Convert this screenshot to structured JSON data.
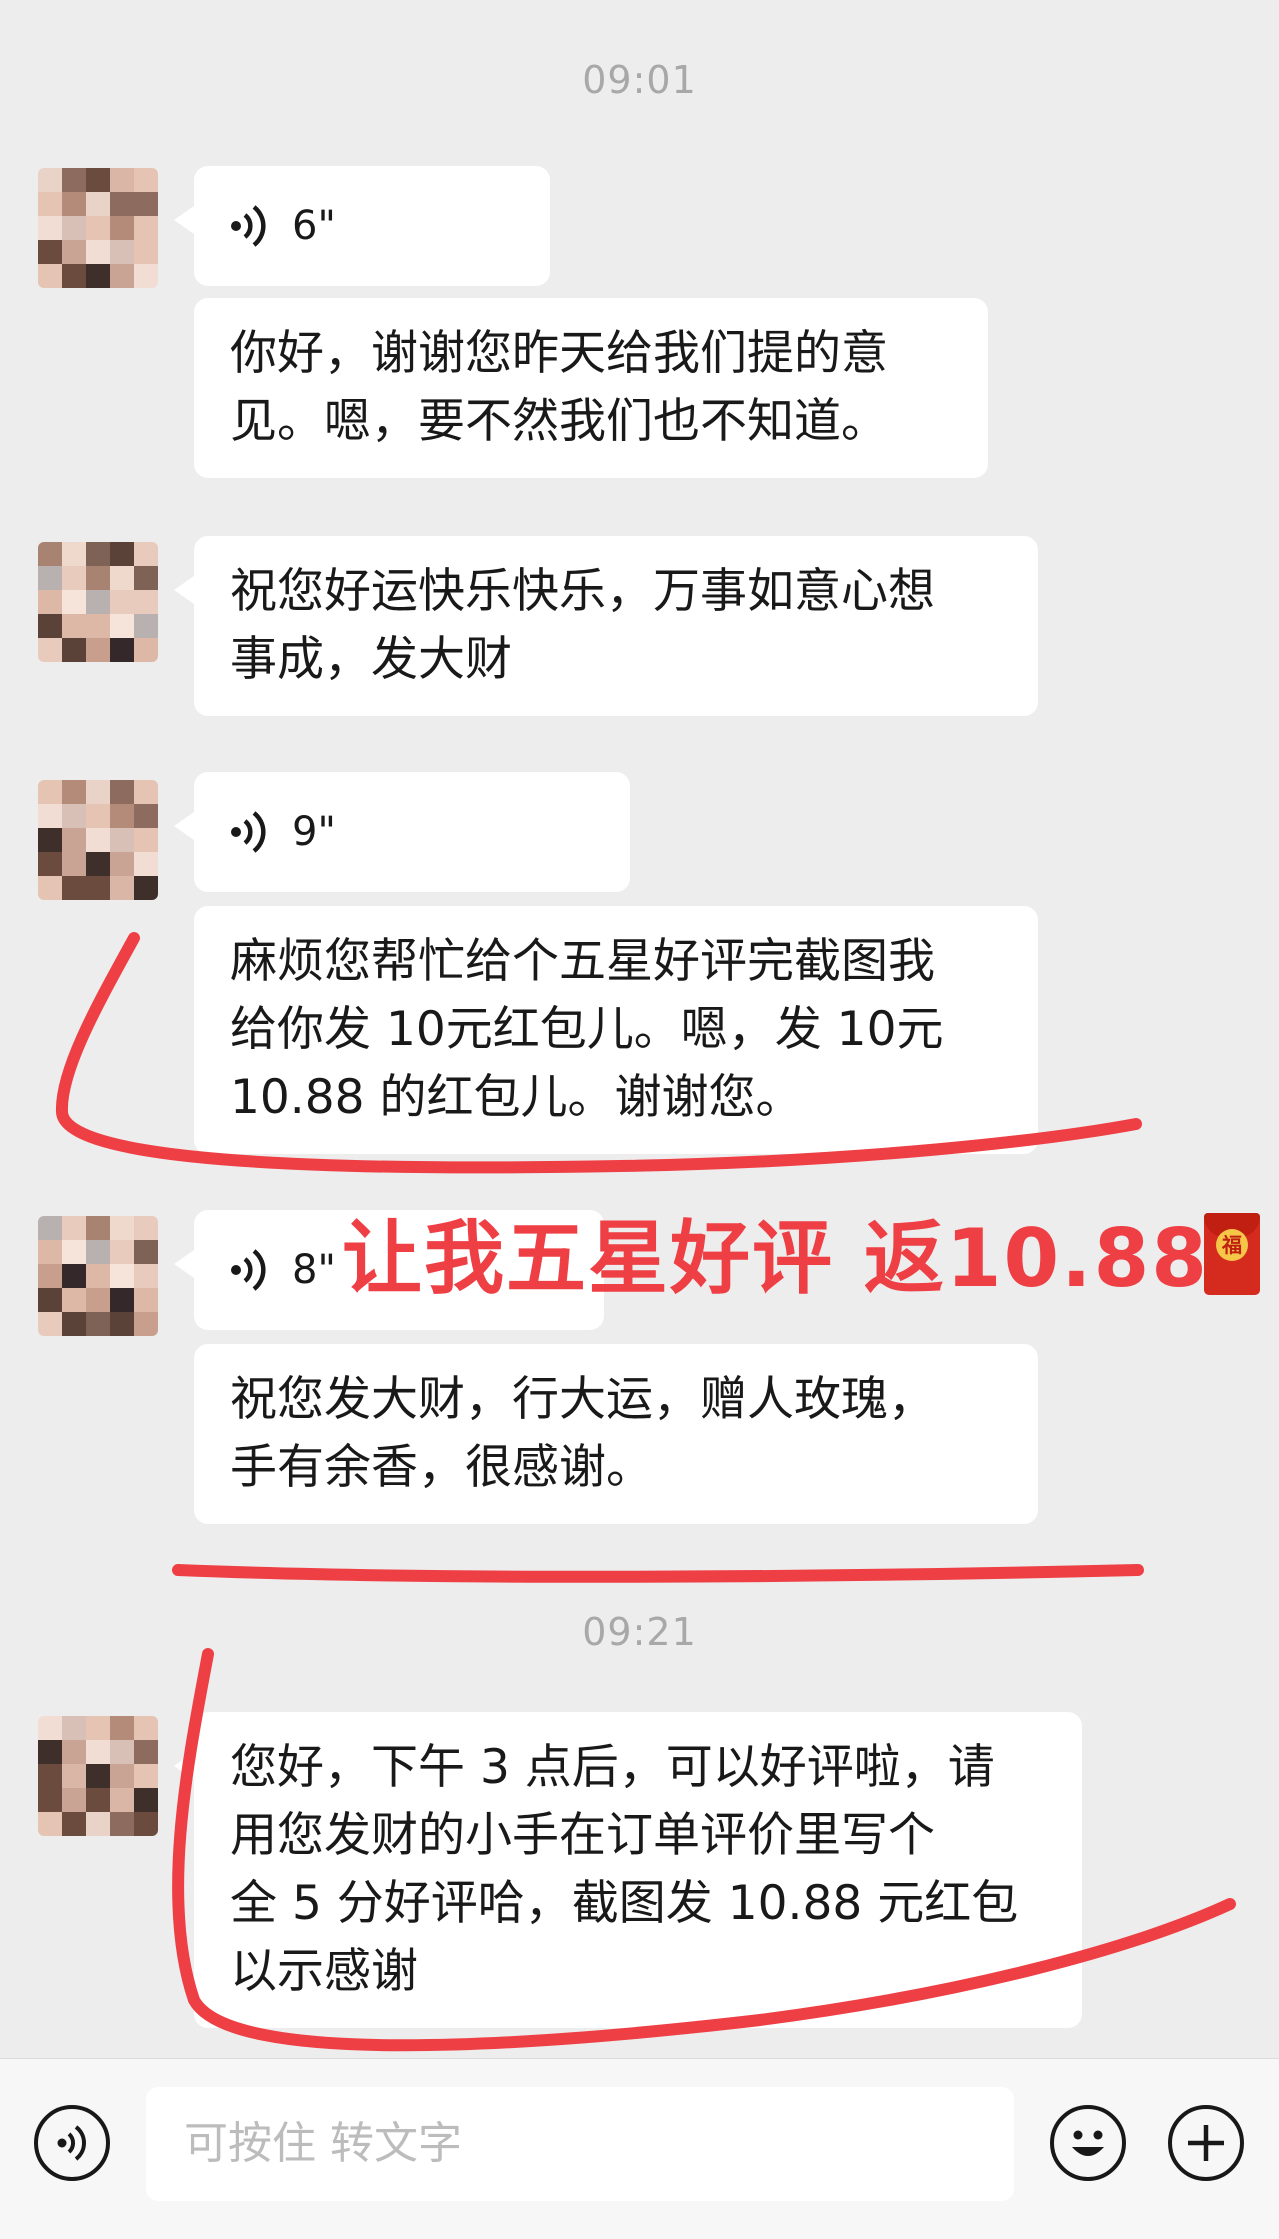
{
  "chat": {
    "times": [
      "09:01",
      "09:21"
    ],
    "messages": [
      {
        "type": "voice",
        "duration": "6\""
      },
      {
        "type": "text",
        "lines": [
          "你好，谢谢您昨天给我们提的意",
          "见。嗯，要不然我们也不知道。"
        ]
      },
      {
        "type": "text",
        "lines": [
          "祝您好运快乐快乐，万事如意心想",
          "事成，发大财"
        ]
      },
      {
        "type": "voice",
        "duration": "9\""
      },
      {
        "type": "text",
        "lines": [
          "麻烦您帮忙给个五星好评完截图我",
          "给你发 10元红包儿。嗯，发 10元",
          "10.88 的红包儿。谢谢您。"
        ]
      },
      {
        "type": "voice",
        "duration": "8\""
      },
      {
        "type": "text",
        "lines": [
          "祝您发大财，行大运，赠人玫瑰，",
          "手有余香，很感谢。"
        ]
      },
      {
        "type": "text",
        "lines": [
          "您好，下午 3 点后，可以好评啦，请",
          "用您发财的小手在订单评价里写个",
          "全 5 分好评哈，截图发 10.88 元红包",
          "以示感谢"
        ]
      }
    ]
  },
  "annotation": {
    "text": "让我五星好评 返10.88",
    "color": "#ee3f45",
    "envelope_char": "福"
  },
  "input_bar": {
    "placeholder": "可按住 转文字",
    "voice_icon": "voice-input-icon",
    "emoji_icon": "emoji-icon",
    "more_icon": "plus-icon"
  }
}
